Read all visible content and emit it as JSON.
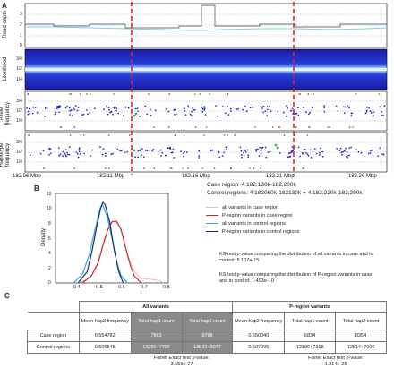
{
  "panelA": {
    "letter": "A",
    "tracks": {
      "read_depth": {
        "label": "Read depth",
        "ticks": [
          "3",
          "2",
          "1",
          "0"
        ]
      },
      "likelihood": {
        "label": "Likelihood",
        "ticks": [
          "3/4",
          "1/2",
          "1/4"
        ]
      },
      "allele_frequency": {
        "label": "Allele frequency",
        "ticks": [
          "3/4",
          "1/2",
          "1/4"
        ]
      },
      "haplotype_frequency": {
        "label": "Haplotype frequency",
        "ticks": [
          "3/4",
          "1/2",
          "1/4"
        ]
      }
    },
    "xticks": [
      "182.06 Mbp",
      "182.11 Mbp",
      "182.16 Mbp",
      "182.21 Mbp",
      "182.26 Mbp"
    ],
    "case_region": "Case region: 4:182,130k-182,200k",
    "control_regions": "Control regions: 4:182060k-182130k + 4:182,220k-182,290k",
    "colors": {
      "boundary": "#e0202a",
      "depth_line": "#7ed0e0",
      "heat_dark": "#1a1aa8",
      "heat_light": "#bfe6ff",
      "points": "#1f2fd0",
      "highlight": "#2ab02a"
    }
  },
  "panelB": {
    "letter": "B",
    "ylabel": "Density",
    "yticks": [
      "12",
      "10",
      "8",
      "6",
      "4",
      "2",
      "0"
    ],
    "xticks": [
      "0.4",
      "0.5",
      "0.6",
      "0.7",
      "0.8"
    ],
    "legend": [
      {
        "label": "all variants in case region",
        "color": "#f2b8b8"
      },
      {
        "label": "P-region variants in case region",
        "color": "#cc2a2a"
      },
      {
        "label": "all variants in control regions",
        "color": "#3aa8d8"
      },
      {
        "label": "P-region variants in control regions",
        "color": "#182f78"
      }
    ],
    "ks_all": "KS-test p-value comparing the distribution of all variants in case and in control: 5.107e-15",
    "ks_p": "KS-test p-value comparing the distribution of P-region variants in case and in control: 1.493e-10"
  },
  "panelC": {
    "letter": "C",
    "groups": {
      "all": "All variants",
      "p": "P-region variants"
    },
    "cols": {
      "mean": "Mean hap2 frequency",
      "hap1": "Total hap1 count",
      "hap2": "Total hap2 count"
    },
    "rows": [
      {
        "name": "Case region",
        "all_mean": "0.554782",
        "all_hap1": "7863",
        "all_hap2": "9798",
        "p_mean": "0.550040",
        "p_hap1": "6834",
        "p_hap2": "8354"
      },
      {
        "name": "Control regions",
        "all_mean": "0.506546",
        "all_hap1": "13256+7796",
        "all_hap2": "13533+8077",
        "p_mean": "0.507995",
        "p_hap1": "12199+7318",
        "p_hap2": "12514+7006"
      }
    ],
    "fisher_all_label": "Fisher Exact test p-value:",
    "fisher_all_value": "3.659e-27",
    "fisher_p_label": "Fisher Exact test p-value:",
    "fisher_p_value": "1.314e-25"
  },
  "chart_data": {
    "type": "line",
    "title": "",
    "xlabel": "",
    "ylabel": "Density",
    "xlim": [
      0.3,
      0.8
    ],
    "ylim": [
      0,
      12
    ],
    "series": [
      {
        "name": "all variants in case region",
        "x": [
          0.4,
          0.45,
          0.48,
          0.5,
          0.52,
          0.54,
          0.56,
          0.58,
          0.6,
          0.62,
          0.65,
          0.68,
          0.72,
          0.76,
          0.78
        ],
        "values": [
          0,
          0.6,
          2,
          4,
          6.2,
          7.8,
          8.3,
          7.8,
          6.2,
          3.8,
          1.5,
          0.6,
          0.5,
          0.3,
          0
        ]
      },
      {
        "name": "P-region variants in case region",
        "x": [
          0.42,
          0.46,
          0.49,
          0.51,
          0.53,
          0.55,
          0.57,
          0.59,
          0.61,
          0.63,
          0.65,
          0.68
        ],
        "values": [
          0,
          1,
          2.8,
          5,
          7,
          8.2,
          8.3,
          7.2,
          4.8,
          2.5,
          0.9,
          0
        ]
      },
      {
        "name": "all variants in control regions",
        "x": [
          0.38,
          0.42,
          0.45,
          0.47,
          0.49,
          0.5,
          0.51,
          0.53,
          0.55,
          0.57,
          0.59,
          0.62
        ],
        "values": [
          0,
          1.2,
          3.8,
          6.5,
          9,
          10.2,
          10.4,
          8.8,
          6,
          3,
          1,
          0
        ]
      },
      {
        "name": "P-region variants in control regions",
        "x": [
          0.4,
          0.44,
          0.46,
          0.48,
          0.5,
          0.51,
          0.52,
          0.54,
          0.56,
          0.58,
          0.6
        ],
        "values": [
          0,
          1.5,
          4,
          7.2,
          10,
          10.8,
          10.5,
          8.2,
          4.5,
          1.5,
          0
        ]
      }
    ]
  }
}
